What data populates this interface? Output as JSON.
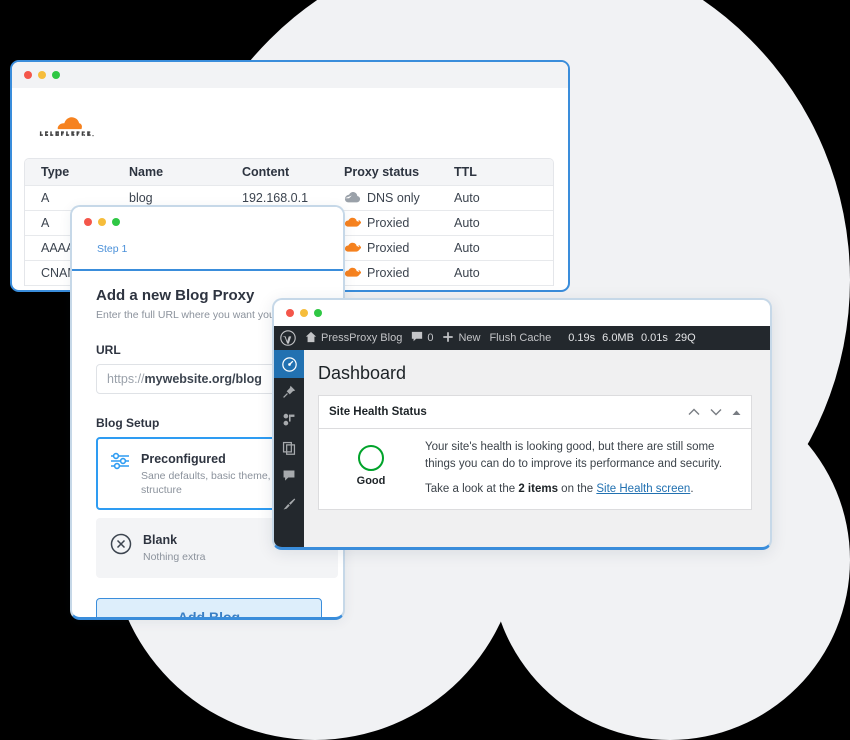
{
  "background": {
    "page_bg": "#000000",
    "blob_color": "#f1f2f4"
  },
  "cloudflare_window": {
    "name": "Cloudflare DNS records window",
    "border_color": "#3a8ddb",
    "logo_text": "CLOUDFLARE",
    "logo_color": "#f6821f",
    "table": {
      "columns": [
        "Type",
        "Name",
        "Content",
        "Proxy status",
        "TTL"
      ],
      "rows": [
        {
          "type": "A",
          "name": "blog",
          "content": "192.168.0.1",
          "proxy_icon": "cloud-gray-icon",
          "proxy": "DNS only",
          "ttl": "Auto"
        },
        {
          "type": "A",
          "name": "",
          "content": "",
          "proxy_icon": "cloud-orange-icon",
          "proxy": "Proxied",
          "ttl": "Auto"
        },
        {
          "type": "AAAA",
          "name": "",
          "content": "",
          "proxy_icon": "cloud-orange-icon",
          "proxy": "Proxied",
          "ttl": "Auto"
        },
        {
          "type": "CNAME",
          "name": "",
          "content": "",
          "proxy_icon": "cloud-orange-icon",
          "proxy": "Proxied",
          "ttl": "Auto"
        }
      ]
    }
  },
  "blog_modal": {
    "name": "Add a new Blog Proxy dialog",
    "step_tab": "Step 1",
    "title": "Add a new Blog Proxy",
    "subtitle": "Enter the full URL where you want your",
    "url_label": "URL",
    "url_scheme": "https://",
    "url_host": "mywebsite.org/blog",
    "url_placeholder": "https://mywebsite.org/blog",
    "setup_label": "Blog Setup",
    "options": [
      {
        "icon": "sliders-icon",
        "title": "Preconfigured",
        "description": "Sane defaults, basic theme, and structure",
        "selected": true
      },
      {
        "icon": "x-circle-icon",
        "title": "Blank",
        "description": "Nothing extra",
        "selected": false
      }
    ],
    "submit_label": "Add Blog",
    "accent_color": "#3a8ddb"
  },
  "wordpress_window": {
    "name": "WordPress dashboard window",
    "admin_bar": {
      "logo_icon": "wordpress-logo-icon",
      "home_icon": "home-icon",
      "site_name": "PressProxy Blog",
      "comments_icon": "comment-icon",
      "comments_count": "0",
      "new_icon": "plus-icon",
      "new_label": "New",
      "flush_cache_label": "Flush Cache",
      "perf": [
        "0.19s",
        "6.0MB",
        "0.01s",
        "29Q"
      ]
    },
    "sidebar_items": [
      {
        "icon": "dashboard-gauge-icon",
        "name": "dashboard",
        "active": true
      },
      {
        "icon": "pin-icon",
        "name": "posts",
        "active": false
      },
      {
        "icon": "media-icon",
        "name": "media",
        "active": false
      },
      {
        "icon": "pages-icon",
        "name": "pages",
        "active": false
      },
      {
        "icon": "comment-icon",
        "name": "comments",
        "active": false
      },
      {
        "icon": "brush-icon",
        "name": "appearance",
        "active": false
      }
    ],
    "page_title": "Dashboard",
    "site_health": {
      "panel_title": "Site Health Status",
      "actions": [
        "chevron-up-icon",
        "chevron-down-icon",
        "collapse-triangle-icon"
      ],
      "status_label": "Good",
      "status_color": "#00a32a",
      "paragraph": "Your site's health is looking good, but there are still some things you can do to improve its performance and security.",
      "cta_prefix": "Take a look at the ",
      "cta_items": "2 items",
      "cta_middle": " on the ",
      "cta_link": "Site Health screen",
      "cta_suffix": "."
    }
  }
}
